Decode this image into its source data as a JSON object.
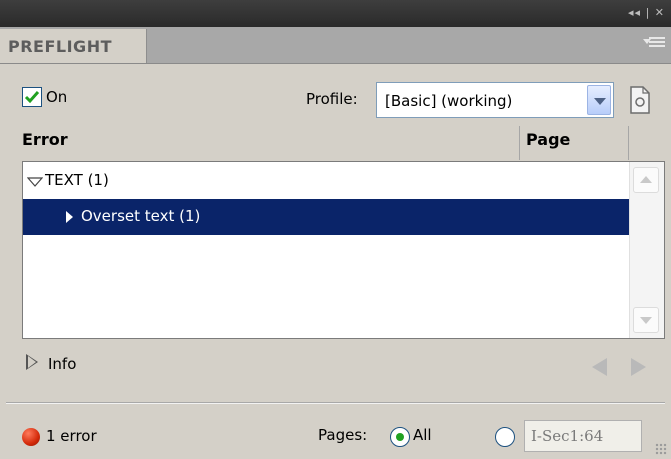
{
  "panel": {
    "tab_label": "PREFLIGHT"
  },
  "controls": {
    "on_label": "On",
    "on_checked": true,
    "profile_label": "Profile:",
    "profile_value": "[Basic] (working)"
  },
  "columns": {
    "error": "Error",
    "page": "Page"
  },
  "errors": [
    {
      "label": "TEXT (1)",
      "expanded": true,
      "selected": false
    },
    {
      "label": "Overset text (1)",
      "expanded": false,
      "selected": true
    }
  ],
  "info": {
    "label": "Info"
  },
  "footer": {
    "status_text": "1 error",
    "status_color": "#d42a0a",
    "pages_label": "Pages:",
    "all_label": "All",
    "all_selected": true,
    "range_value": "I-Sec1:64"
  },
  "colors": {
    "selection": "#0a2469",
    "accent_check": "#21a121"
  }
}
